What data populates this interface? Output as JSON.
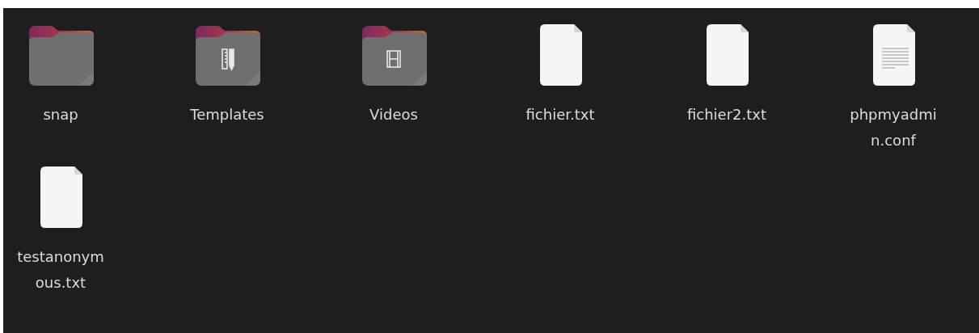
{
  "items": [
    {
      "kind": "folder",
      "label_lines": [
        "snap"
      ]
    },
    {
      "kind": "folder-templates",
      "label_lines": [
        "Templates"
      ]
    },
    {
      "kind": "folder-videos",
      "label_lines": [
        "Videos"
      ]
    },
    {
      "kind": "file",
      "label_lines": [
        "fichier.txt"
      ]
    },
    {
      "kind": "file",
      "label_lines": [
        "fichier2.txt"
      ]
    },
    {
      "kind": "text-file",
      "label_lines": [
        "phpmyadmi",
        "n.conf"
      ]
    },
    {
      "kind": "file",
      "label_lines": [
        "testanonym",
        "ous.txt"
      ]
    }
  ]
}
